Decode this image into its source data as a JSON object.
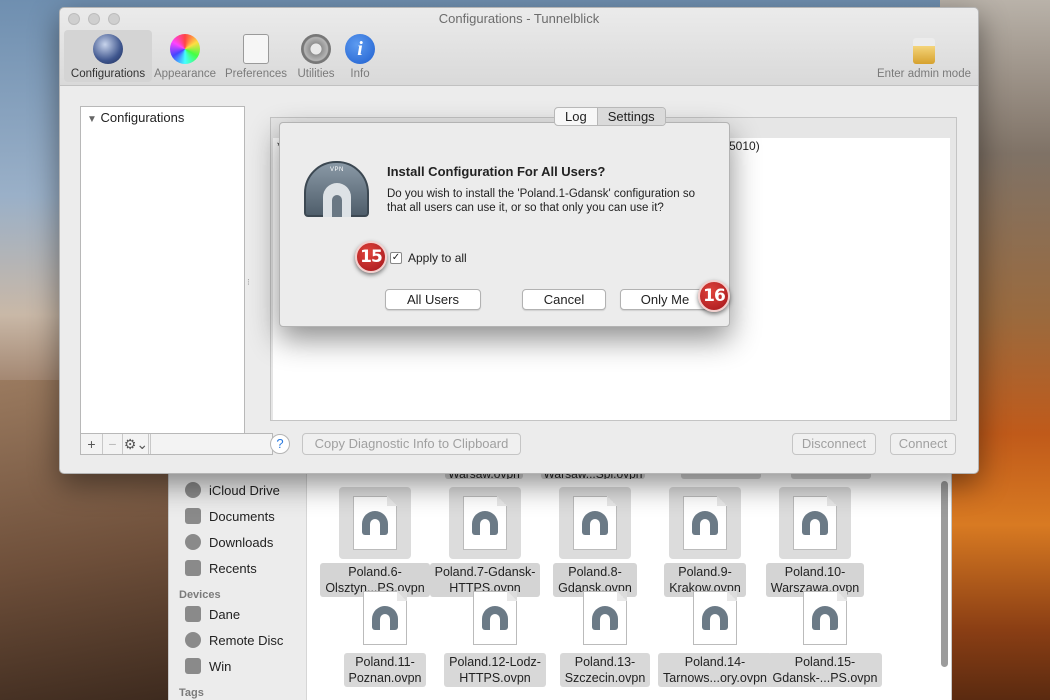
{
  "window": {
    "title": "Configurations - Tunnelblick",
    "toolbar": [
      {
        "label": "Configurations",
        "icon": "globe-icon"
      },
      {
        "label": "Appearance",
        "icon": "color-wheel-icon"
      },
      {
        "label": "Preferences",
        "icon": "light-switch-icon"
      },
      {
        "label": "Utilities",
        "icon": "gear-icon"
      },
      {
        "label": "Info",
        "icon": "info-icon"
      }
    ],
    "admin_label": "Enter admin mode"
  },
  "sidebar": {
    "header": "Configurations"
  },
  "tabs": [
    "Log",
    "Settings"
  ],
  "panel": {
    "left_text": "*",
    "right_text": "5010)"
  },
  "bottom": {
    "help": "?",
    "copy_button": "Copy Diagnostic Info to Clipboard",
    "disconnect_button": "Disconnect",
    "connect_button": "Connect"
  },
  "dialog": {
    "vpn_tag": "VPN",
    "title": "Install Configuration For All Users?",
    "message": "Do you wish to install the 'Poland.1-Gdansk' configuration so that all users can use it, or so that only you can use it?",
    "checkbox_label": "Apply to all",
    "checkbox_checked": true,
    "check_mark": "✓",
    "buttons": {
      "all_users": "All Users",
      "cancel": "Cancel",
      "only_me": "Only Me"
    }
  },
  "badges": {
    "step15": "15",
    "step16": "16"
  },
  "finder": {
    "sidebar": {
      "items": [
        "iCloud Drive",
        "Documents",
        "Downloads",
        "Recents"
      ],
      "devices_header": "Devices",
      "devices": [
        "Dane",
        "Remote Disc",
        "Win"
      ],
      "tags_header": "Tags"
    },
    "top_row_partial": [
      "Warsaw.ovpn",
      "Warsaw...Spl.ovpn"
    ],
    "row1": [
      {
        "line1": "Poland.6-",
        "line2": "Olsztyn...PS.ovpn"
      },
      {
        "line1": "Poland.7-Gdansk-",
        "line2": "HTTPS.ovpn"
      },
      {
        "line1": "Poland.8-",
        "line2": "Gdansk.ovpn"
      },
      {
        "line1": "Poland.9-",
        "line2": "Krakow.ovpn"
      },
      {
        "line1": "Poland.10-",
        "line2": "Warszawa.ovpn"
      }
    ],
    "row2": [
      {
        "line1": "Poland.11-",
        "line2": "Poznan.ovpn"
      },
      {
        "line1": "Poland.12-Lodz-",
        "line2": "HTTPS.ovpn"
      },
      {
        "line1": "Poland.13-",
        "line2": "Szczecin.ovpn"
      },
      {
        "line1": "Poland.14-",
        "line2": "Tarnows...ory.ovpn"
      },
      {
        "line1": "Poland.15-",
        "line2": "Gdansk-...PS.ovpn"
      }
    ]
  },
  "colors": {
    "badge": "#c0272d",
    "accent": "#2a7adf"
  }
}
